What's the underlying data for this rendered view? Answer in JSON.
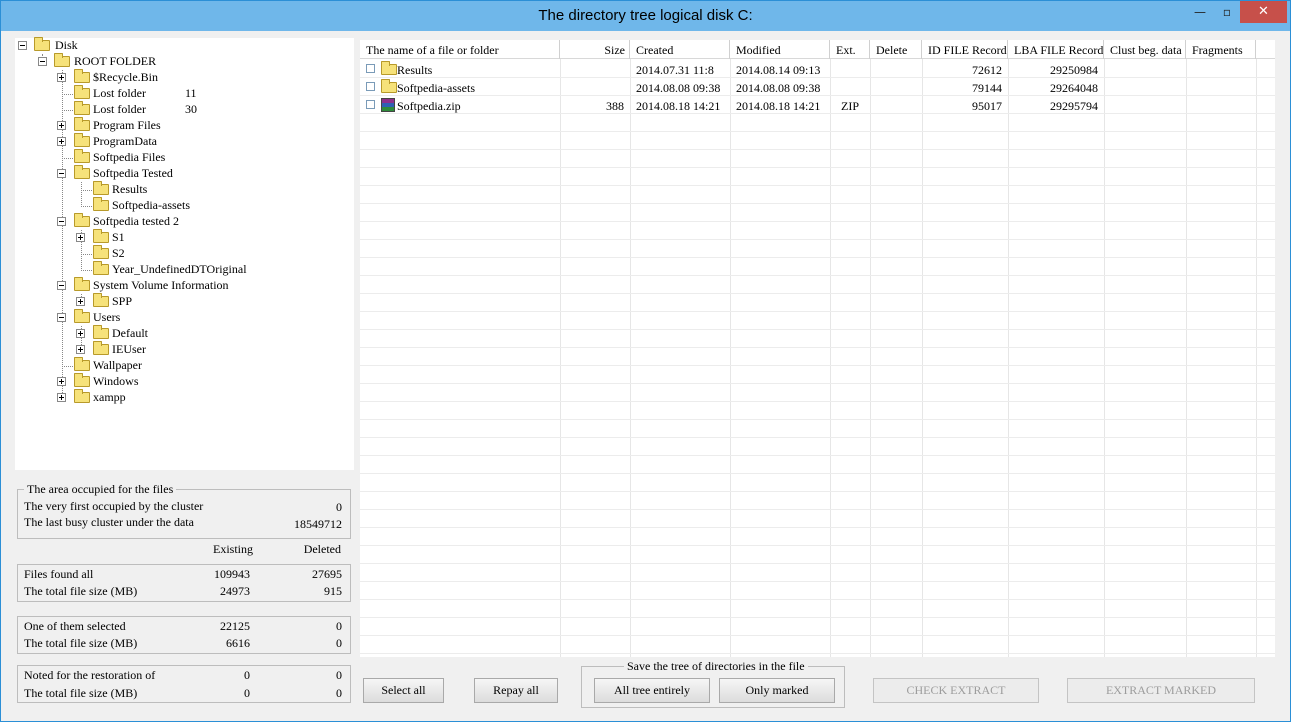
{
  "window": {
    "title": "The directory tree logical disk C:",
    "minimize": "—",
    "maximize": "▫",
    "close": "✕"
  },
  "tree": {
    "nodes": [
      {
        "label": "Disk",
        "count": ""
      },
      {
        "label": "ROOT FOLDER",
        "count": ""
      },
      {
        "label": "$Recycle.Bin",
        "count": ""
      },
      {
        "label": "Lost folder",
        "count": "11"
      },
      {
        "label": "Lost folder",
        "count": "30"
      },
      {
        "label": "Program Files",
        "count": ""
      },
      {
        "label": "ProgramData",
        "count": ""
      },
      {
        "label": "Softpedia Files",
        "count": ""
      },
      {
        "label": "Softpedia Tested",
        "count": ""
      },
      {
        "label": "Results",
        "count": ""
      },
      {
        "label": "Softpedia-assets",
        "count": ""
      },
      {
        "label": "Softpedia tested 2",
        "count": ""
      },
      {
        "label": "S1",
        "count": ""
      },
      {
        "label": "S2",
        "count": ""
      },
      {
        "label": "Year_UndefinedDTOriginal",
        "count": ""
      },
      {
        "label": "System Volume Information",
        "count": ""
      },
      {
        "label": "SPP",
        "count": ""
      },
      {
        "label": "Users",
        "count": ""
      },
      {
        "label": "Default",
        "count": ""
      },
      {
        "label": "IEUser",
        "count": ""
      },
      {
        "label": "Wallpaper",
        "count": ""
      },
      {
        "label": "Windows",
        "count": ""
      },
      {
        "label": "xampp",
        "count": ""
      }
    ]
  },
  "area": {
    "title": "The area occupied for the files",
    "first_label": "The very first occupied by the cluster",
    "first_value": "0",
    "last_label": "The last busy cluster under the data",
    "last_value": "18549712"
  },
  "columns": {
    "existing": "Existing",
    "deleted": "Deleted"
  },
  "found": {
    "files_label": "Files found all",
    "files_existing": "109943",
    "files_deleted": "27695",
    "size_label": "The total file size (MB)",
    "size_existing": "24973",
    "size_deleted": "915"
  },
  "selected": {
    "files_label": "One of them selected",
    "files_existing": "22125",
    "files_deleted": "0",
    "size_label": "The total file size (MB)",
    "size_existing": "6616",
    "size_deleted": "0"
  },
  "noted": {
    "files_label": "Noted for the restoration of",
    "files_existing": "0",
    "files_deleted": "0",
    "size_label": "The total file size (MB)",
    "size_existing": "0",
    "size_deleted": "0"
  },
  "grid": {
    "headers": [
      "The name of a file or folder",
      "Size",
      "Created",
      "Modified",
      "Ext.",
      "Delete",
      "ID FILE Record",
      "LBA FILE Record",
      "Clust beg. data",
      "Fragments"
    ],
    "rows": [
      {
        "name": "Results",
        "size": "",
        "created": "2014.07.31 11:8",
        "modified": "2014.08.14 09:13",
        "ext": "",
        "delete": "",
        "id": "72612",
        "lba": "29250984",
        "clust": "",
        "frag": "",
        "icon": "folder-icon"
      },
      {
        "name": "Softpedia-assets",
        "size": "",
        "created": "2014.08.08 09:38",
        "modified": "2014.08.08 09:38",
        "ext": "",
        "delete": "",
        "id": "79144",
        "lba": "29264048",
        "clust": "",
        "frag": "",
        "icon": "folder-icon"
      },
      {
        "name": "Softpedia.zip",
        "size": "388",
        "created": "2014.08.18 14:21",
        "modified": "2014.08.18 14:21",
        "ext": "ZIP",
        "delete": "",
        "id": "95017",
        "lba": "29295794",
        "clust": "",
        "frag": "",
        "icon": "zip-archive-icon"
      }
    ]
  },
  "buttons": {
    "select_all": "Select all",
    "repay_all": "Repay all",
    "save_group_title": "Save the tree of directories in the file",
    "all_tree": "All tree entirely",
    "only_marked": "Only marked",
    "check_extract": "CHECK EXTRACT",
    "extract_marked": "EXTRACT MARKED"
  }
}
